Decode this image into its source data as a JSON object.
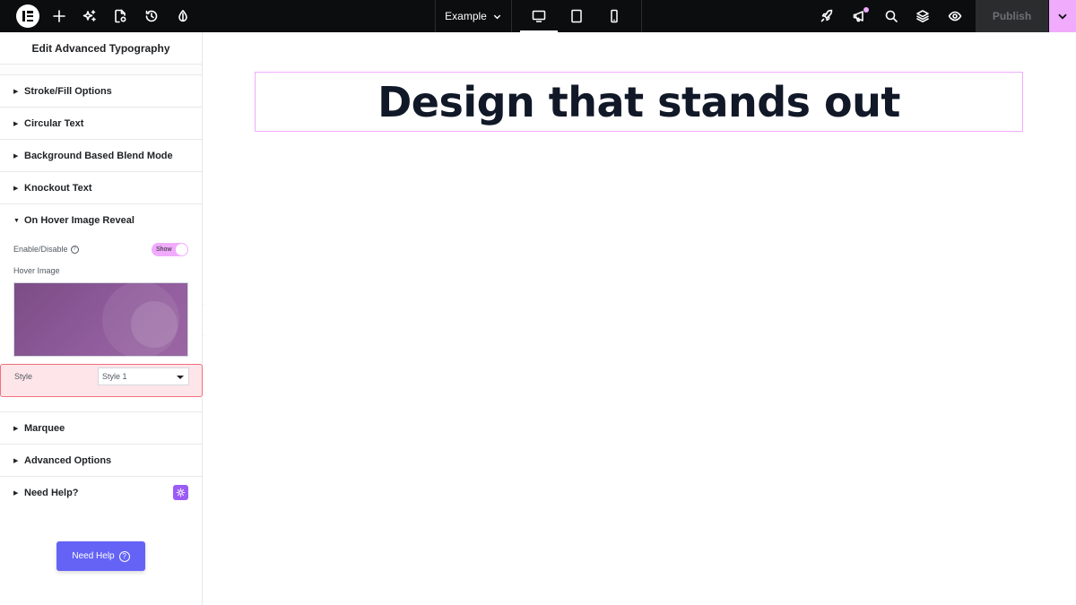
{
  "topbar": {
    "page_name": "Example",
    "publish_label": "Publish",
    "icons": [
      "elementor-logo-icon",
      "plus-icon",
      "sparkle-icon",
      "page-settings-icon",
      "history-icon",
      "site-settings-icon",
      "desktop-icon",
      "tablet-icon",
      "mobile-icon",
      "rocket-icon",
      "megaphone-icon",
      "search-icon",
      "layers-icon",
      "eye-icon",
      "chevron-down-icon"
    ],
    "accent_color": "#f0abfc"
  },
  "panel": {
    "title": "Edit Advanced Typography",
    "sections": {
      "stroke_fill": "Stroke/Fill Options",
      "circular": "Circular Text",
      "blend": "Background Based Blend Mode",
      "knockout": "Knockout Text",
      "hover_reveal": "On Hover Image Reveal",
      "marquee": "Marquee",
      "advanced": "Advanced Options",
      "need_help": "Need Help?"
    },
    "hover_reveal": {
      "enable_label": "Enable/Disable",
      "toggle_text": "Show",
      "hover_image_label": "Hover Image",
      "style_label": "Style",
      "style_value": "Style 1"
    },
    "need_help_button": "Need Help"
  },
  "canvas": {
    "heading": "Design that stands out"
  }
}
